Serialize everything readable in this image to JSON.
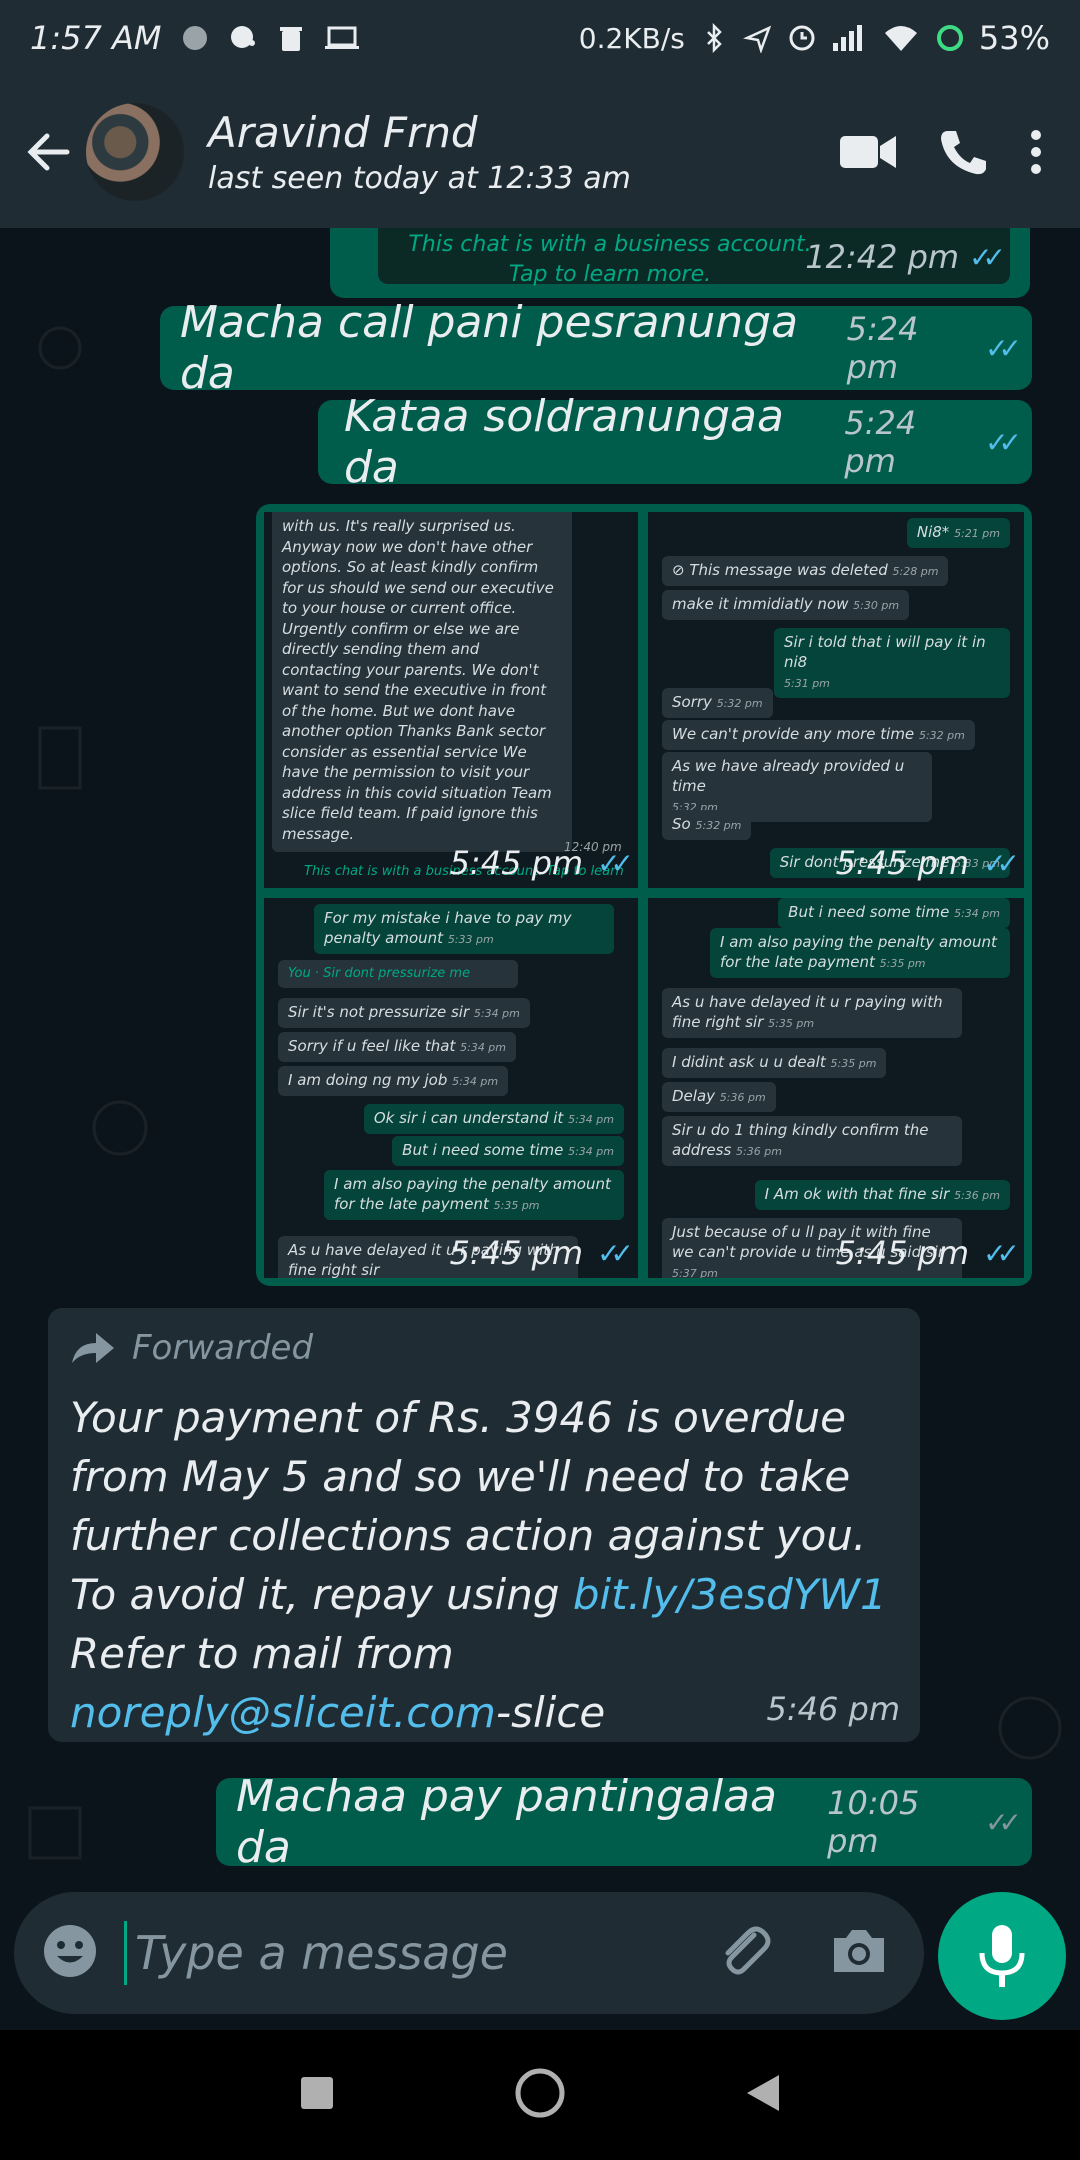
{
  "status_bar": {
    "time": "1:57 AM",
    "network_speed": "0.2KB/s",
    "battery": "53%"
  },
  "header": {
    "contact_name": "Aravind Frnd",
    "last_seen": "last seen today at 12:33 am"
  },
  "messages": {
    "business_notice": {
      "text": "This chat is with a business account. Tap to learn more.",
      "time": "12:42 pm"
    },
    "msg1": {
      "text": "Macha call pani pesranunga da",
      "time": "5:24 pm"
    },
    "msg2": {
      "text": "Kataa soldranungaa da",
      "time": "5:24 pm"
    },
    "images": [
      {
        "time": "5:45 pm"
      },
      {
        "time": "5:45 pm"
      },
      {
        "time": "5:45 pm"
      },
      {
        "time": "5:45 pm"
      }
    ],
    "forwarded": {
      "label": "Forwarded",
      "text_1": "Your payment of Rs. 3946 is overdue from May 5 and so we'll need to take further collections action against you. To avoid it, repay using ",
      "link": "bit.ly/3esdYW1",
      "text_2": " Refer to mail from ",
      "email": "noreply@sliceit.com",
      "text_3": "-slice",
      "time": "5:46 pm"
    },
    "msg3": {
      "text": "Machaa pay pantingalaa da",
      "time": "10:05 pm"
    }
  },
  "screenshot_texts": {
    "tile1": {
      "body": "with us. It's really surprised us. Anyway now we don't have other options. So at least kindly confirm for us should we send our executive to your house or current office. Urgently confirm or else we are directly sending them and contacting your parents. We don't want to send the executive in front of the home. But we dont have another option Thanks Bank sector consider as essential service We have the permission to visit your address in this covid situation Team slice field team. If paid ignore this message.",
      "body_time": "12:40 pm",
      "biz": "This chat is with a business account. Tap to learn"
    },
    "tile2": [
      {
        "t": "Ni8*",
        "time": "5:21 pm",
        "out": true
      },
      {
        "t": "This message was deleted",
        "time": "5:28 pm",
        "out": false
      },
      {
        "t": "make it immidiatly now",
        "time": "5:30 pm",
        "out": false
      },
      {
        "t": "Sir i told that i will pay it in ni8",
        "time": "5:31 pm",
        "out": true
      },
      {
        "t": "Sorry",
        "time": "5:32 pm",
        "out": false
      },
      {
        "t": "We can't provide any more time",
        "time": "5:32 pm",
        "out": false
      },
      {
        "t": "As we have already provided u time",
        "time": "5:32 pm",
        "out": false
      },
      {
        "t": "So",
        "time": "5:32 pm",
        "out": false
      },
      {
        "t": "Sir dont pressurize me",
        "time": "5:33 pm",
        "out": true
      }
    ],
    "tile3": [
      {
        "t": "For my mistake i have to pay my penalty amount",
        "time": "5:33 pm",
        "out": true
      },
      {
        "t": "You · Sir dont pressurize me",
        "time": "",
        "out": false
      },
      {
        "t": "Sir it's not pressurize sir",
        "time": "5:34 pm",
        "out": false
      },
      {
        "t": "Sorry if u feel like that",
        "time": "5:34 pm",
        "out": false
      },
      {
        "t": "I am doing ng my job",
        "time": "5:34 pm",
        "out": false
      },
      {
        "t": "Ok sir i can understand it",
        "time": "5:34 pm",
        "out": true
      },
      {
        "t": "But i need some time",
        "time": "5:34 pm",
        "out": true
      },
      {
        "t": "I am also paying the penalty amount for the late payment",
        "time": "5:35 pm",
        "out": true
      },
      {
        "t": "As u have delayed it u r paying with fine right sir",
        "time": "",
        "out": false
      }
    ],
    "tile4": [
      {
        "t": "But i need some time",
        "time": "5:34 pm",
        "out": true
      },
      {
        "t": "I am also paying the penalty amount for the late payment",
        "time": "5:35 pm",
        "out": true
      },
      {
        "t": "As u have delayed it u r paying with fine right sir",
        "time": "5:35 pm",
        "out": false
      },
      {
        "t": "I didint ask u u dealt",
        "time": "5:35 pm",
        "out": false
      },
      {
        "t": "Delay",
        "time": "5:36 pm",
        "out": false
      },
      {
        "t": "Sir u do 1 thing kindly confirm the address",
        "time": "5:36 pm",
        "out": false
      },
      {
        "t": "I Am ok with that fine sir",
        "time": "5:36 pm",
        "out": true
      },
      {
        "t": "Just because of u ll pay it with fine we can't provide u time as u said sir",
        "time": "5:37 pm",
        "out": false
      }
    ]
  },
  "composer": {
    "placeholder": "Type a message"
  },
  "colors": {
    "outgoing_bubble": "#005c4b",
    "incoming_bubble": "#1f2c34",
    "accent": "#00a884",
    "read_ticks": "#53bdeb",
    "background": "#0b141a"
  },
  "icons": [
    "back-arrow-icon",
    "video-call-icon",
    "voice-call-icon",
    "more-vert-icon",
    "emoji-icon",
    "attach-icon",
    "camera-icon",
    "mic-icon",
    "forward-icon"
  ]
}
